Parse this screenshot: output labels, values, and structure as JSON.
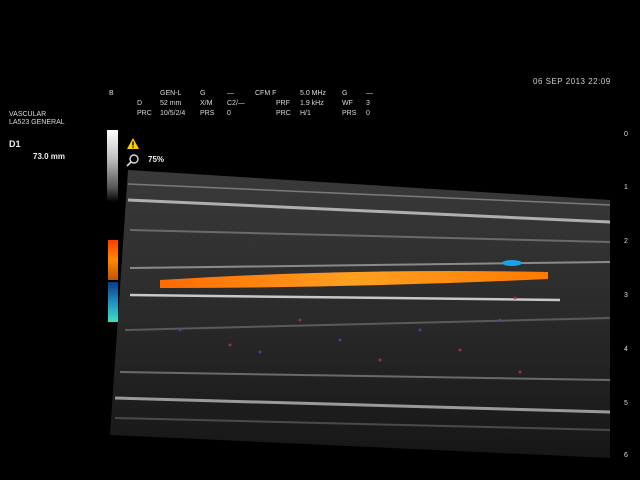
{
  "datetime": "06  SEP  2013  22:09",
  "preset": {
    "line1": "VASCULAR",
    "line2": "LA523   GENERAL"
  },
  "measurement": {
    "label": "D1",
    "value": "73.0 mm"
  },
  "zoom": "75%",
  "params": {
    "mode_b": "B",
    "gen_l": "GEN-L",
    "g": "G",
    "dash1": "—",
    "d": "D",
    "d_val": "52 mm",
    "xm": "X/M",
    "xm_val": "C2/—",
    "prc": "PRC",
    "prc_val": "10/5/2/4",
    "prs": "PRS",
    "prs_val": "0",
    "cfm": "CFM F",
    "cfm_val": "5.0 MHz",
    "g2": "G",
    "dash2": "—",
    "prf": "PRF",
    "prf_val": "1.9 kHz",
    "wf": "WF",
    "wf_val": "3",
    "prc2": "PRC",
    "prc2_val": "H/1",
    "prs2": "PRS",
    "prs2_val": "0"
  },
  "depth_scale": [
    "0",
    "1",
    "2",
    "3",
    "4",
    "5",
    "6"
  ],
  "icons": {
    "warning": "warning-icon",
    "zoom": "magnifier-icon"
  },
  "colors": {
    "doppler_warm": "#ff8a00",
    "doppler_cool": "#1e90c0"
  }
}
